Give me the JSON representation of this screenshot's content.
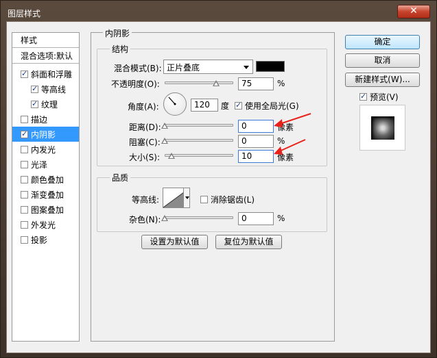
{
  "window": {
    "title": "图层样式",
    "close_glyph": "✕"
  },
  "style_list": {
    "header": "样式",
    "blend_options": "混合选项:默认",
    "items": [
      {
        "label": "斜面和浮雕",
        "checked": true,
        "indent": false
      },
      {
        "label": "等高线",
        "checked": true,
        "indent": true
      },
      {
        "label": "纹理",
        "checked": true,
        "indent": true
      },
      {
        "label": "描边",
        "checked": false,
        "indent": false
      },
      {
        "label": "内阴影",
        "checked": true,
        "indent": false,
        "selected": true
      },
      {
        "label": "内发光",
        "checked": false,
        "indent": false
      },
      {
        "label": "光泽",
        "checked": false,
        "indent": false
      },
      {
        "label": "颜色叠加",
        "checked": false,
        "indent": false
      },
      {
        "label": "渐变叠加",
        "checked": false,
        "indent": false
      },
      {
        "label": "图案叠加",
        "checked": false,
        "indent": false
      },
      {
        "label": "外发光",
        "checked": false,
        "indent": false
      },
      {
        "label": "投影",
        "checked": false,
        "indent": false
      }
    ]
  },
  "panel": {
    "title": "内阴影",
    "structure": {
      "title": "结构",
      "blend_mode_label": "混合模式(B):",
      "blend_mode_value": "正片叠底",
      "shadow_color": "#000000",
      "opacity_label": "不透明度(O):",
      "opacity_value": "75",
      "opacity_percent": 75,
      "opacity_unit": "%",
      "angle_label": "角度(A):",
      "angle_value": "120",
      "angle_unit": "度",
      "global_light_label": "使用全局光(G)",
      "global_light_checked": true,
      "distance_label": "距离(D):",
      "distance_value": "0",
      "distance_unit": "像素",
      "choke_label": "阻塞(C):",
      "choke_value": "0",
      "choke_unit": "%",
      "size_label": "大小(S):",
      "size_value": "10",
      "size_unit": "像素"
    },
    "quality": {
      "title": "品质",
      "contour_label": "等高线:",
      "antialias_label": "消除锯齿(L)",
      "antialias_checked": false,
      "noise_label": "杂色(N):",
      "noise_value": "0",
      "noise_unit": "%"
    },
    "make_default": "设置为默认值",
    "reset_default": "复位为默认值"
  },
  "buttons": {
    "ok": "确定",
    "cancel": "取消",
    "new_style": "新建样式(W)...",
    "preview_label": "预览(V)",
    "preview_checked": true
  },
  "accent_color": "#3399ff",
  "annotation_color": "#e8221a"
}
